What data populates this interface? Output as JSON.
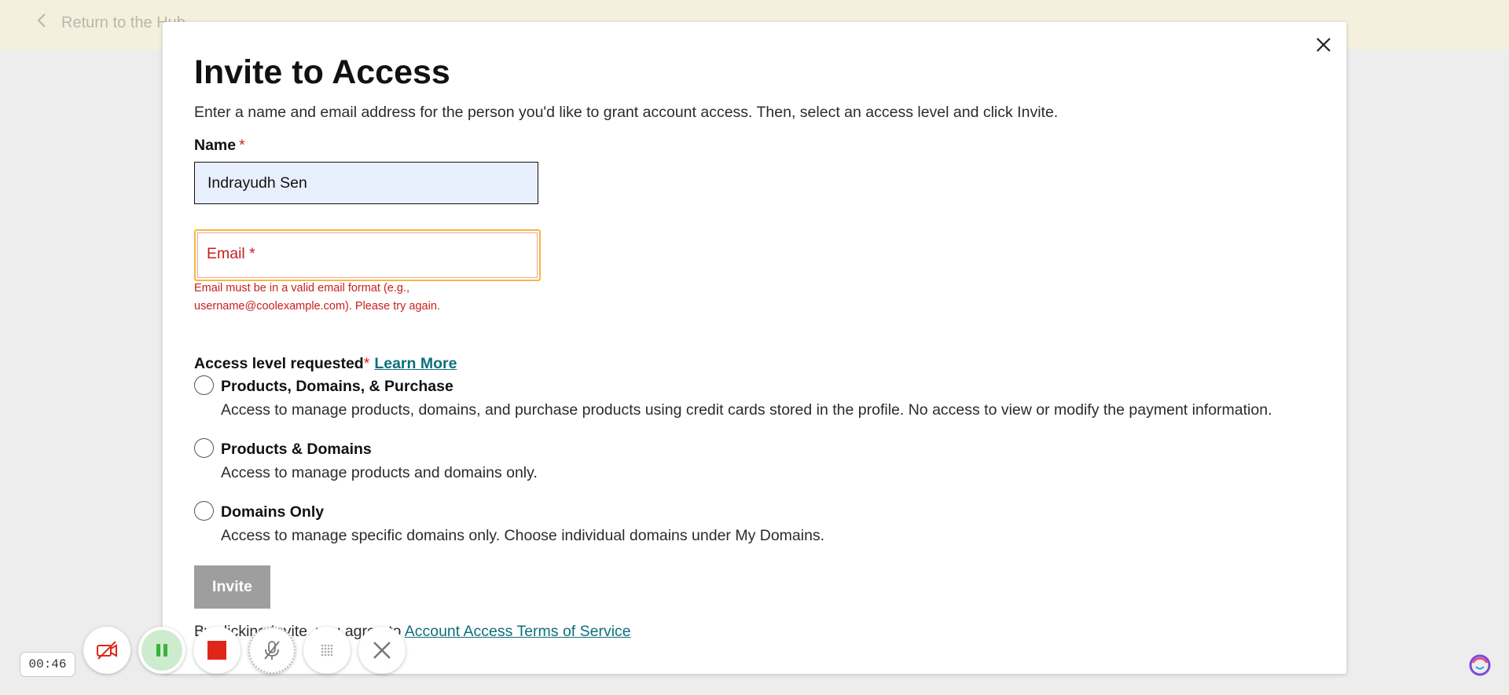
{
  "banner": {
    "back_label": "Return to the Hub"
  },
  "modal": {
    "title": "Invite to Access",
    "description": "Enter a name and email address for the person you'd like to grant account access. Then, select an access level and click Invite.",
    "name_label": "Name",
    "required_mark": "*",
    "name_value": "Indrayudh Sen",
    "email_label": "Email *",
    "email_value": "",
    "email_error": "Email must be in a valid email format (e.g., username@coolexample.com). Please try again.",
    "access_label": "Access level requested",
    "learn_more": "Learn More",
    "options": [
      {
        "title": "Products, Domains, & Purchase",
        "description": "Access to manage products, domains, and purchase products using credit cards stored in the profile. No access to view or modify the payment information."
      },
      {
        "title": "Products & Domains",
        "description": "Access to manage products and domains only."
      },
      {
        "title": "Domains Only",
        "description": "Access to manage specific domains only. Choose individual domains under My Domains."
      }
    ],
    "invite_label": "Invite",
    "terms_prefix": "By clicking Invite, you agree to ",
    "terms_link": "Account Access Terms of Service"
  },
  "recorder": {
    "timer": "00:46",
    "buttons": [
      "camera-off-icon",
      "pause-icon",
      "stop-icon",
      "mic-off-icon",
      "grid-icon",
      "close-icon"
    ]
  },
  "colors": {
    "accent_link": "#0e6f7c",
    "error": "#c81e1e",
    "banner_bg": "#f5f0de",
    "focus_border": "#f6b73c",
    "record_red": "#e0251b",
    "pause_green": "#3bb03b"
  }
}
